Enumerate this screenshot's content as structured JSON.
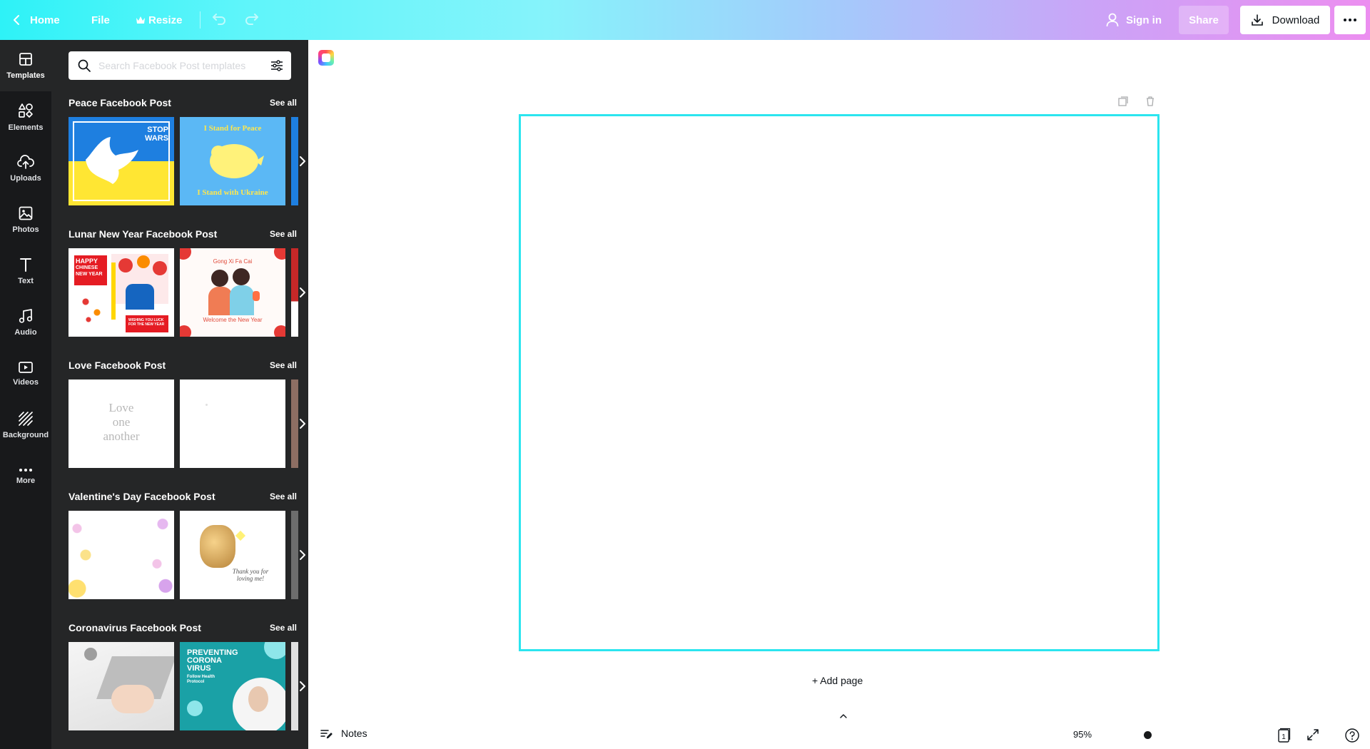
{
  "topbar": {
    "home_label": "Home",
    "file_label": "File",
    "resize_label": "Resize",
    "signin_label": "Sign in",
    "share_label": "Share",
    "download_label": "Download"
  },
  "rail": {
    "items": [
      {
        "label": "Templates",
        "icon": "layout-icon"
      },
      {
        "label": "Elements",
        "icon": "shapes-icon"
      },
      {
        "label": "Uploads",
        "icon": "cloud-upload-icon"
      },
      {
        "label": "Photos",
        "icon": "image-icon"
      },
      {
        "label": "Text",
        "icon": "text-icon"
      },
      {
        "label": "Audio",
        "icon": "music-note-icon"
      },
      {
        "label": "Videos",
        "icon": "video-icon"
      },
      {
        "label": "Background",
        "icon": "hatch-icon"
      },
      {
        "label": "More",
        "icon": "more-dots-icon"
      }
    ]
  },
  "panel": {
    "search_placeholder": "Search Facebook Post templates",
    "sections": [
      {
        "title": "Peace Facebook Post",
        "see_all": "See all",
        "thumb1": {
          "line1": "STOP",
          "line2": "WARS"
        },
        "thumb2": {
          "top": "I Stand for Peace",
          "bottom": "I Stand with Ukraine"
        }
      },
      {
        "title": "Lunar New Year Facebook Post",
        "see_all": "See all",
        "thumb1": {
          "line1": "HAPPY",
          "line2": "CHINESE",
          "line3": "NEW YEAR",
          "footer": "WISHING YOU LUCK FOR THE NEW YEAR"
        },
        "thumb2": {
          "top": "Gong Xi Fa Cai",
          "bottom": "Welcome the New Year"
        }
      },
      {
        "title": "Love Facebook Post",
        "see_all": "See all",
        "thumb1": {
          "line1": "Love",
          "line2": "one",
          "line3": "another"
        }
      },
      {
        "title": "Valentine's Day Facebook Post",
        "see_all": "See all",
        "thumb2": {
          "caption1": "Thank you for",
          "caption2": "loving me!"
        }
      },
      {
        "title": "Coronavirus Facebook Post",
        "see_all": "See all",
        "thumb2": {
          "line1": "PREVENTING",
          "line2": "CORONA",
          "line3": "VIRUS",
          "sub1": "Follow Health",
          "sub2": "Protocol"
        }
      }
    ]
  },
  "canvas": {
    "add_page_label": "+ Add page",
    "border_color": "#2be5ef"
  },
  "bottombar": {
    "notes_label": "Notes",
    "zoom_label": "95%",
    "page_count": "1"
  }
}
